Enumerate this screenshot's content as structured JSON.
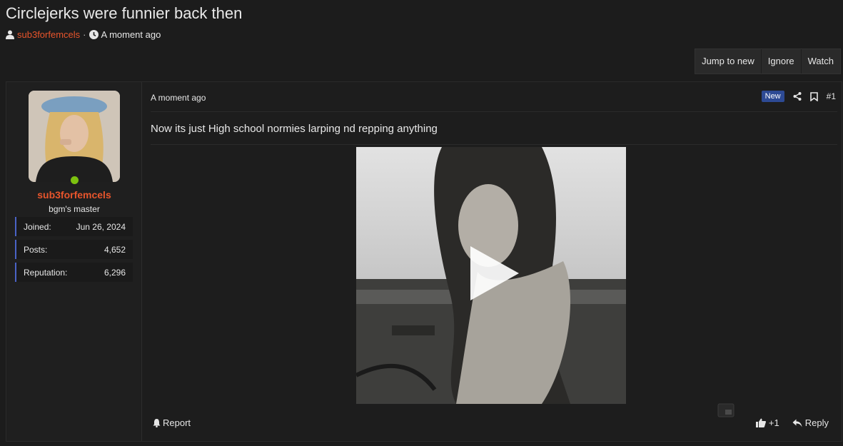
{
  "thread": {
    "title": "Circlejerks were funnier back then",
    "author": "sub3forfemcels",
    "separator": "·",
    "time": "A moment ago"
  },
  "actions": {
    "jump": "Jump to new",
    "ignore": "Ignore",
    "watch": "Watch"
  },
  "user": {
    "name": "sub3forfemcels",
    "title": "bgm's master",
    "stats": [
      {
        "label": "Joined:",
        "value": "Jun 26, 2024"
      },
      {
        "label": "Posts:",
        "value": "4,652"
      },
      {
        "label": "Reputation:",
        "value": "6,296"
      }
    ]
  },
  "post": {
    "date": "A moment ago",
    "badge": "New",
    "number": "#1",
    "body": "Now its just High school normies larping nd repping anything",
    "report": "Report",
    "likes": "+1",
    "reply": "Reply"
  },
  "colors": {
    "accent": "#e8552c",
    "background": "#1c1c1c",
    "badge": "#2d4a94",
    "stat_border": "#4a63c6",
    "online": "#7cc10f"
  }
}
